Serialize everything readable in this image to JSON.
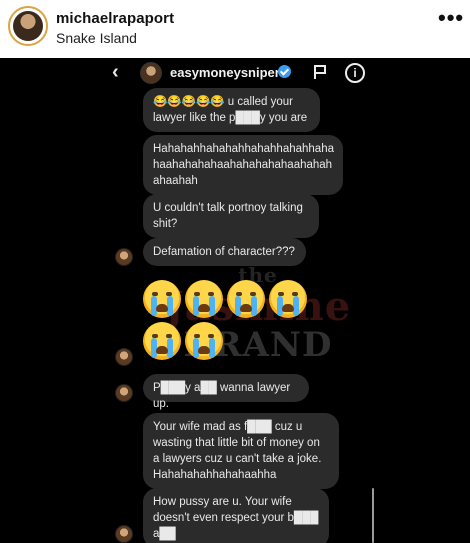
{
  "post": {
    "username": "michaelrapaport",
    "location": "Snake Island",
    "more_label": "•••"
  },
  "dm": {
    "back_label": "‹",
    "contact_name": "easymoneysniper",
    "info_label": "i"
  },
  "messages": [
    {
      "text": "😂😂😂😂😂 u called your lawyer like  the p███y you are"
    },
    {
      "text": "Hahahahhahahahhahahhahahhaha haahahahahaahahahahahaahahah ahaahah"
    },
    {
      "text": "U couldn't talk portnoy talking shit?"
    },
    {
      "text": "Defamation of character???"
    },
    {
      "text": "😭😭😭😭😭😭"
    },
    {
      "text": "P███y a██ wanna lawyer up."
    },
    {
      "text": "Your wife mad as f███ cuz u wasting that little bit of money on a lawyers cuz u can't take a joke. Hahahahahhahahaahha"
    },
    {
      "text": "How pussy are u. Your wife doesn't even respect your b███ a██"
    }
  ],
  "watermark": {
    "line1": "the",
    "line2": "Jasmine",
    "line3": "BRAND"
  }
}
